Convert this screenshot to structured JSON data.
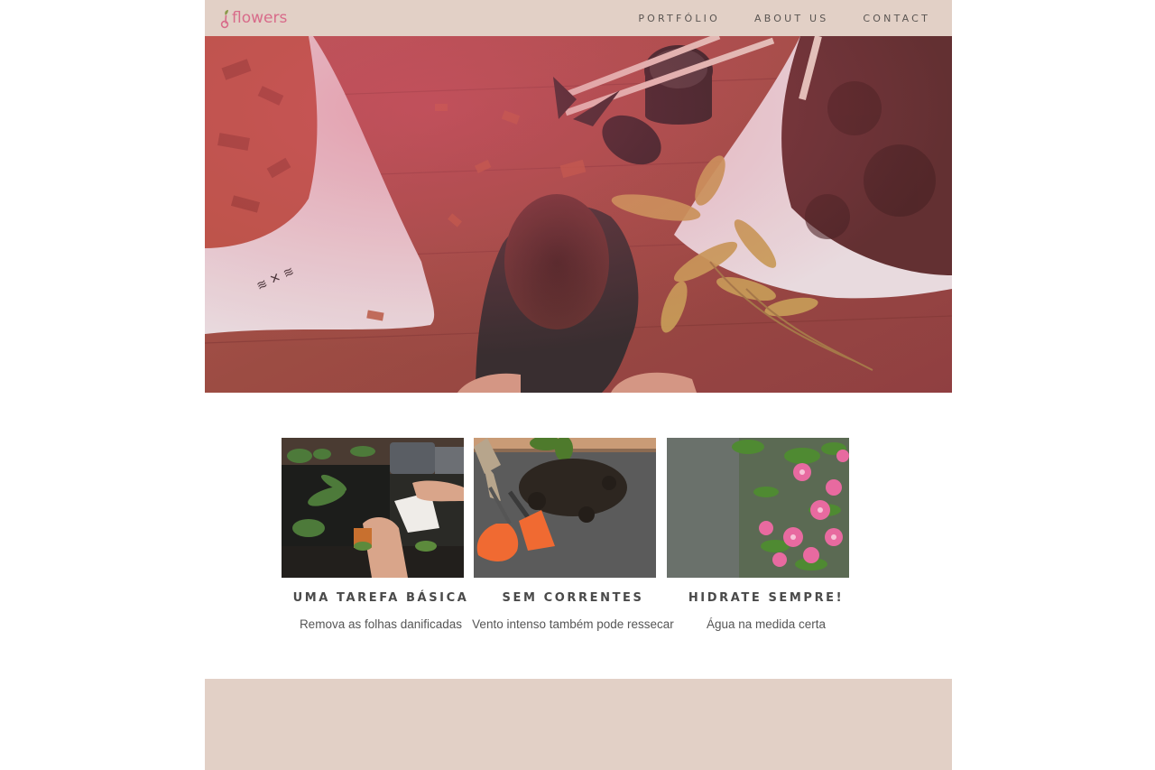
{
  "brand": {
    "name": "flowers",
    "color": "#d86b8a"
  },
  "nav": {
    "items": [
      {
        "label": "PORTFÓLIO"
      },
      {
        "label": "ABOUT US"
      },
      {
        "label": "CONTACT"
      }
    ]
  },
  "cards": [
    {
      "title": "UMA TAREFA BÁSICA",
      "description": "Remova as folhas danificadas"
    },
    {
      "title": "SEM CORRENTES",
      "description": "Vento intenso também pode ressecar"
    },
    {
      "title": "HIDRATE SEMPRE!",
      "description": "Água na medida certa"
    }
  ],
  "colors": {
    "header_bg": "#e2d0c6",
    "footer_bg": "#e2d0c6",
    "nav_text": "#5a5552",
    "card_title": "#4a4a4a"
  }
}
